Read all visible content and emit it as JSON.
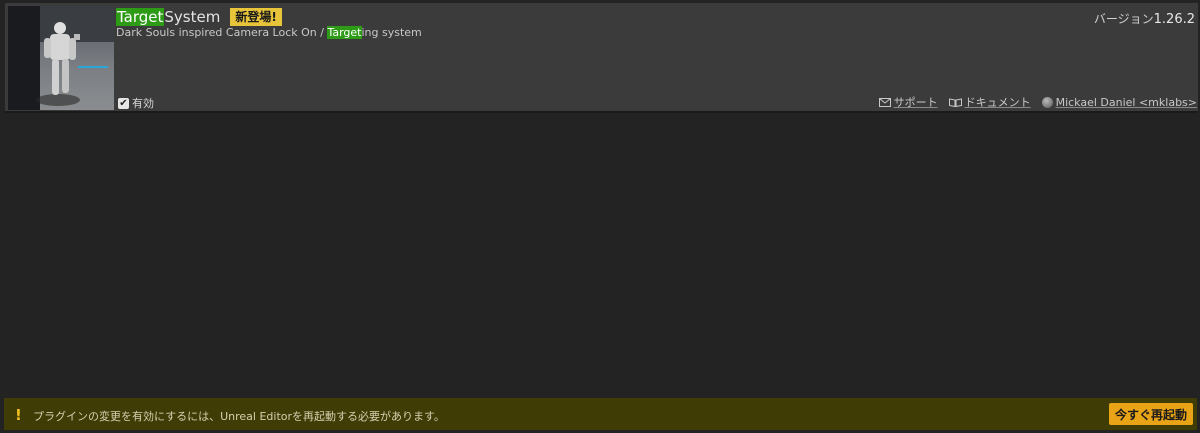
{
  "plugin": {
    "title_highlight": "Target",
    "title_rest": "System",
    "new_badge": "新登場!",
    "description_prefix": "Dark Souls inspired Camera Lock On / ",
    "description_highlight": "Target",
    "description_suffix": "ing system",
    "version_label": "バージョン",
    "version_number": "1.26.2",
    "enabled_label": "有効",
    "enabled": true,
    "support_label": "サポート",
    "docs_label": "ドキュメント",
    "author_label": "Mickael Daniel <mklabs>"
  },
  "restart_bar": {
    "message": "プラグインの変更を有効にするには、Unreal Editorを再起動する必要があります。",
    "button_label": "今すぐ再起動"
  },
  "colors": {
    "highlight": "#2e9b16",
    "badge": "#e7c43a",
    "warning_bar": "#403c05",
    "restart_button": "#e8a317"
  }
}
